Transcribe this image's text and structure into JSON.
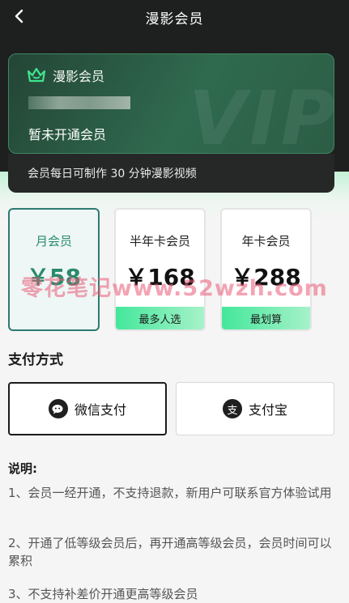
{
  "nav": {
    "title": "漫影会员"
  },
  "vip_card": {
    "brand": "漫影会员",
    "status": "暂未开通会员",
    "watermark": "VIP",
    "footer": "会员每日可制作 30 分钟漫影视频"
  },
  "plans": [
    {
      "name": "月会员",
      "price": "￥58",
      "badge": "",
      "selected": true
    },
    {
      "name": "半年卡会员",
      "price": "￥168",
      "badge": "最多人选",
      "selected": false
    },
    {
      "name": "年卡会员",
      "price": "￥288",
      "badge": "最划算",
      "selected": false
    }
  ],
  "overlay_watermark": "零花笔记www.52wzh.com",
  "payment": {
    "title": "支付方式",
    "options": [
      {
        "label": "微信支付",
        "icon": "wechat-icon",
        "selected": true
      },
      {
        "label": "支付宝",
        "icon": "alipay-icon",
        "selected": false
      }
    ]
  },
  "notes": {
    "title": "说明:",
    "items": [
      "1、会员一经开通，不支持退款，新用户可联系官方体验试用",
      "2、开通了低等级会员后，再开通高等级会员，会员时间可以累积",
      "3、不支持补差价开通更高等级会员"
    ]
  },
  "colors": {
    "header_bg": "#1e1f1f",
    "accent_green": "#2a8a6c",
    "badge_green": "#44e79b"
  }
}
